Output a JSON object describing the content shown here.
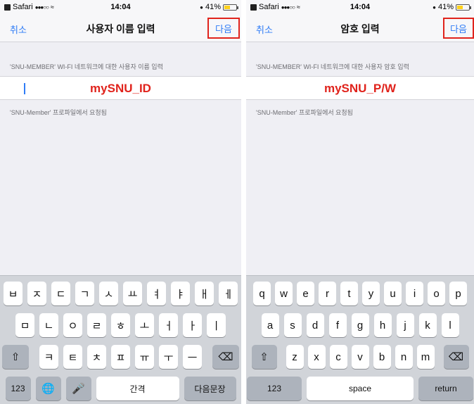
{
  "status_bar": {
    "carrier": "Safari",
    "signal": "●●●○○",
    "time": "14:04",
    "battery": "41%"
  },
  "left": {
    "cancel": "취소",
    "title": "사용자 이름 입력",
    "next": "다음",
    "header": "'SNU-MEMBER' WI-FI 네트워크에 대한 사용자 이름 입력",
    "overlay": "mySNU_ID",
    "footer": "'SNU-Member' 프로파일에서 요청됨",
    "keyboard": {
      "row1": [
        "ㅂ",
        "ㅈ",
        "ㄷ",
        "ㄱ",
        "ㅅ",
        "ㅛ",
        "ㅕ",
        "ㅑ",
        "ㅐ",
        "ㅔ"
      ],
      "row2": [
        "ㅁ",
        "ㄴ",
        "ㅇ",
        "ㄹ",
        "ㅎ",
        "ㅗ",
        "ㅓ",
        "ㅏ",
        "ㅣ"
      ],
      "row3": [
        "ㅋ",
        "ㅌ",
        "ㅊ",
        "ㅍ",
        "ㅠ",
        "ㅜ",
        "ㅡ"
      ],
      "numbers": "123",
      "space": "간격",
      "return": "다음문장"
    }
  },
  "right": {
    "cancel": "취소",
    "title": "암호 입력",
    "next": "다음",
    "header": "'SNU-MEMBER' WI-FI 네트워크에 대한 사용자 암호 입력",
    "overlay": "mySNU_P/W",
    "footer": "'SNU-Member' 프로파일에서 요청됨",
    "keyboard": {
      "row1": [
        "q",
        "w",
        "e",
        "r",
        "t",
        "y",
        "u",
        "i",
        "o",
        "p"
      ],
      "row2": [
        "a",
        "s",
        "d",
        "f",
        "g",
        "h",
        "j",
        "k",
        "l"
      ],
      "row3": [
        "z",
        "x",
        "c",
        "v",
        "b",
        "n",
        "m"
      ],
      "numbers": "123",
      "space": "space",
      "return": "return"
    }
  },
  "colors": {
    "accent": "#2f7cf6",
    "annotation": "#e0231c"
  }
}
